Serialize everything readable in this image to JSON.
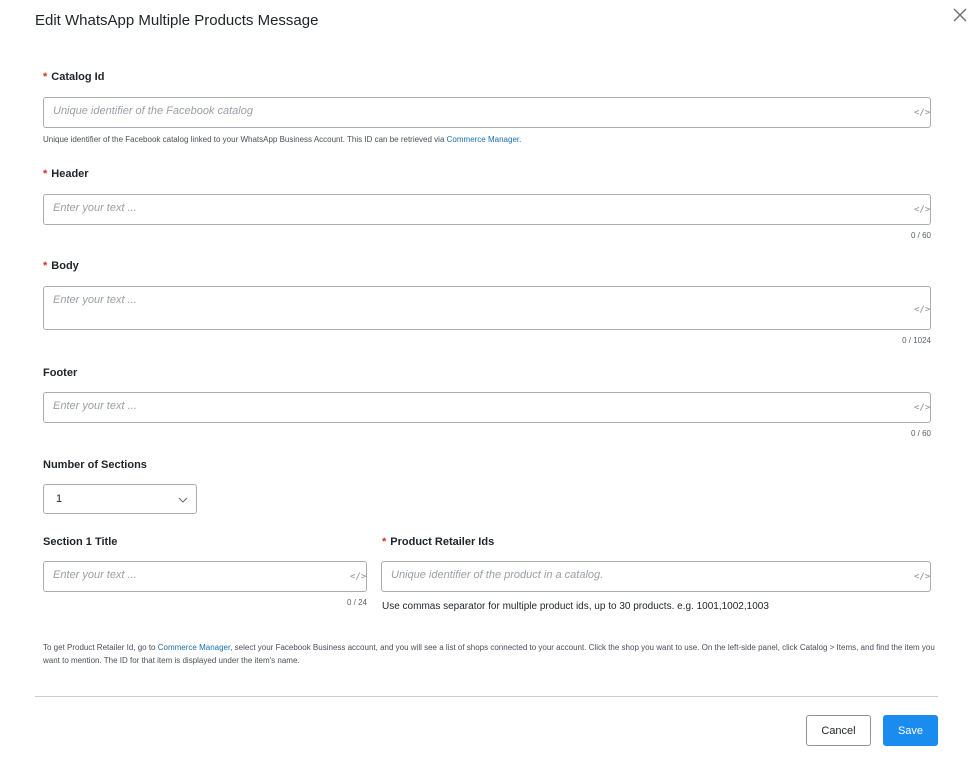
{
  "dialog": {
    "title": "Edit WhatsApp Multiple Products Message"
  },
  "fields": {
    "required_mark": "*",
    "code_symbol": "</>",
    "catalog_id": {
      "label": "Catalog Id",
      "placeholder": "Unique identifier of the Facebook catalog",
      "help_prefix": "Unique identifier of the Facebook catalog linked to your WhatsApp Business Account. This ID can be retrieved via ",
      "help_link": "Commerce Manager",
      "help_suffix": "."
    },
    "header": {
      "label": "Header",
      "placeholder": "Enter your text ...",
      "counter": "0 / 60"
    },
    "body": {
      "label": "Body",
      "placeholder": "Enter your text ...",
      "counter": "0 / 1024"
    },
    "footer": {
      "label": "Footer",
      "placeholder": "Enter your text ...",
      "counter": "0 / 60"
    },
    "number_of_sections": {
      "label": "Number of Sections",
      "value": "1"
    },
    "section_1_title": {
      "label": "Section 1 Title",
      "placeholder": "Enter your text ...",
      "counter": "0 / 24"
    },
    "product_retailer_ids": {
      "label": "Product Retailer Ids",
      "placeholder": "Unique identifier of the product in a catalog.",
      "help": "Use commas separator for multiple product ids, up to 30 products. e.g. 1001,1002,1003"
    }
  },
  "note": {
    "prefix": "To get Product Retailer Id, go to ",
    "link": "Commerce Manager",
    "suffix": ", select your Facebook Business account, and you will see a list of shops connected to your account. Click the shop you want to use. On the left-side panel, click Catalog > Items, and find the item you want to mention. The ID for that item is displayed under the item's name."
  },
  "actions": {
    "cancel": "Cancel",
    "save": "Save"
  },
  "icons": {
    "close": "close-icon",
    "code": "code-icon",
    "chevron": "chevron-down-icon"
  },
  "colors": {
    "primary": "#1a8cf0",
    "link": "#1a6fb0",
    "required": "#d93025",
    "border": "#a9acb1"
  }
}
